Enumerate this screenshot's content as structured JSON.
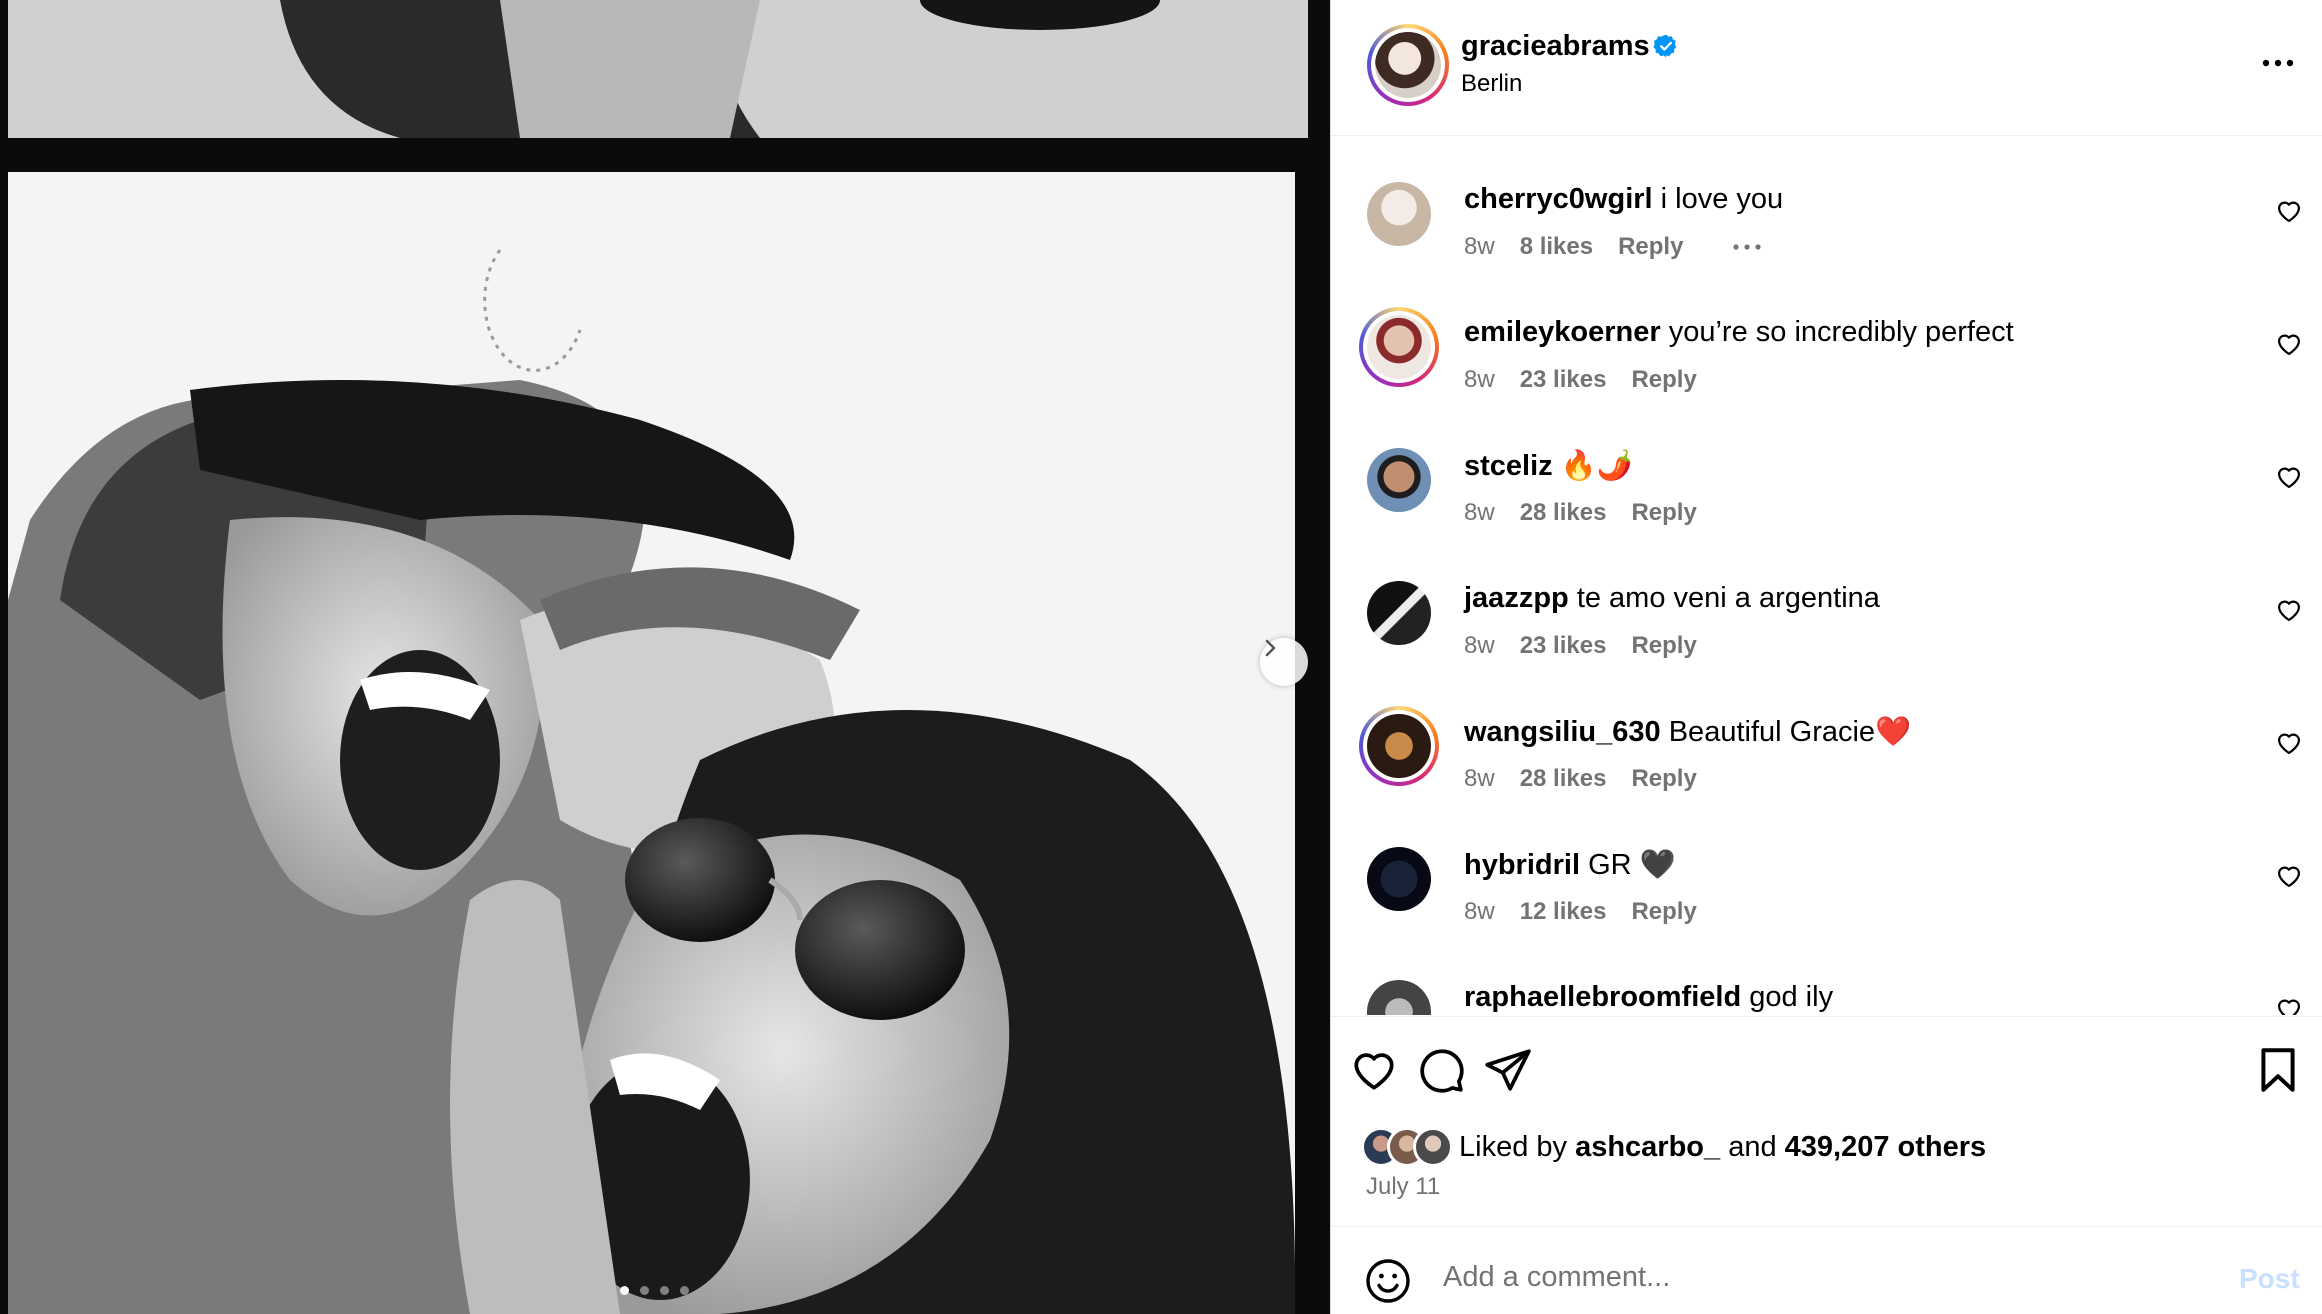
{
  "post": {
    "author": "gracieabrams",
    "location": "Berlin",
    "verified": true
  },
  "carousel": {
    "count": 4,
    "active_index": 0
  },
  "comments": [
    {
      "username": "cherryc0wgirl",
      "text": "i love you",
      "age": "8w",
      "likes": "8 likes",
      "reply": "Reply",
      "has_story": false,
      "show_more": true
    },
    {
      "username": "emileykoerner",
      "text": "you’re so incredibly perfect",
      "age": "8w",
      "likes": "23 likes",
      "reply": "Reply",
      "has_story": true,
      "show_more": false
    },
    {
      "username": "stceliz",
      "text": "🔥🌶️",
      "age": "8w",
      "likes": "28 likes",
      "reply": "Reply",
      "has_story": false,
      "show_more": false
    },
    {
      "username": "jaazzpp",
      "text": "te amo veni a argentina",
      "age": "8w",
      "likes": "23 likes",
      "reply": "Reply",
      "has_story": false,
      "show_more": false
    },
    {
      "username": "wangsiliu_630",
      "text": "Beautiful Gracie❤️",
      "age": "8w",
      "likes": "28 likes",
      "reply": "Reply",
      "has_story": true,
      "show_more": false
    },
    {
      "username": "hybridril",
      "text": "GR 🖤",
      "age": "8w",
      "likes": "12 likes",
      "reply": "Reply",
      "has_story": false,
      "show_more": false
    },
    {
      "username": "raphaellebroomfield",
      "text": "god ily",
      "age": "",
      "likes": "",
      "reply": "",
      "has_story": false,
      "show_more": false
    }
  ],
  "likes": {
    "prefix": "Liked by",
    "first_liker": "ashcarbo_",
    "joiner": "and",
    "others": "439,207 others"
  },
  "date": "July 11",
  "composer": {
    "placeholder": "Add a comment...",
    "post_label": "Post"
  },
  "colors": {
    "verified": "#0095f6",
    "muted": "#737373",
    "post_disabled": "#c7e0fd",
    "divider": "#efefef"
  },
  "icons": {
    "verified": "verified-badge-icon",
    "more": "more-options-icon",
    "next": "chevron-right-icon",
    "like": "heart-icon",
    "comment": "speech-bubble-icon",
    "share": "paper-plane-icon",
    "save": "bookmark-icon",
    "emoji": "smiley-icon"
  }
}
